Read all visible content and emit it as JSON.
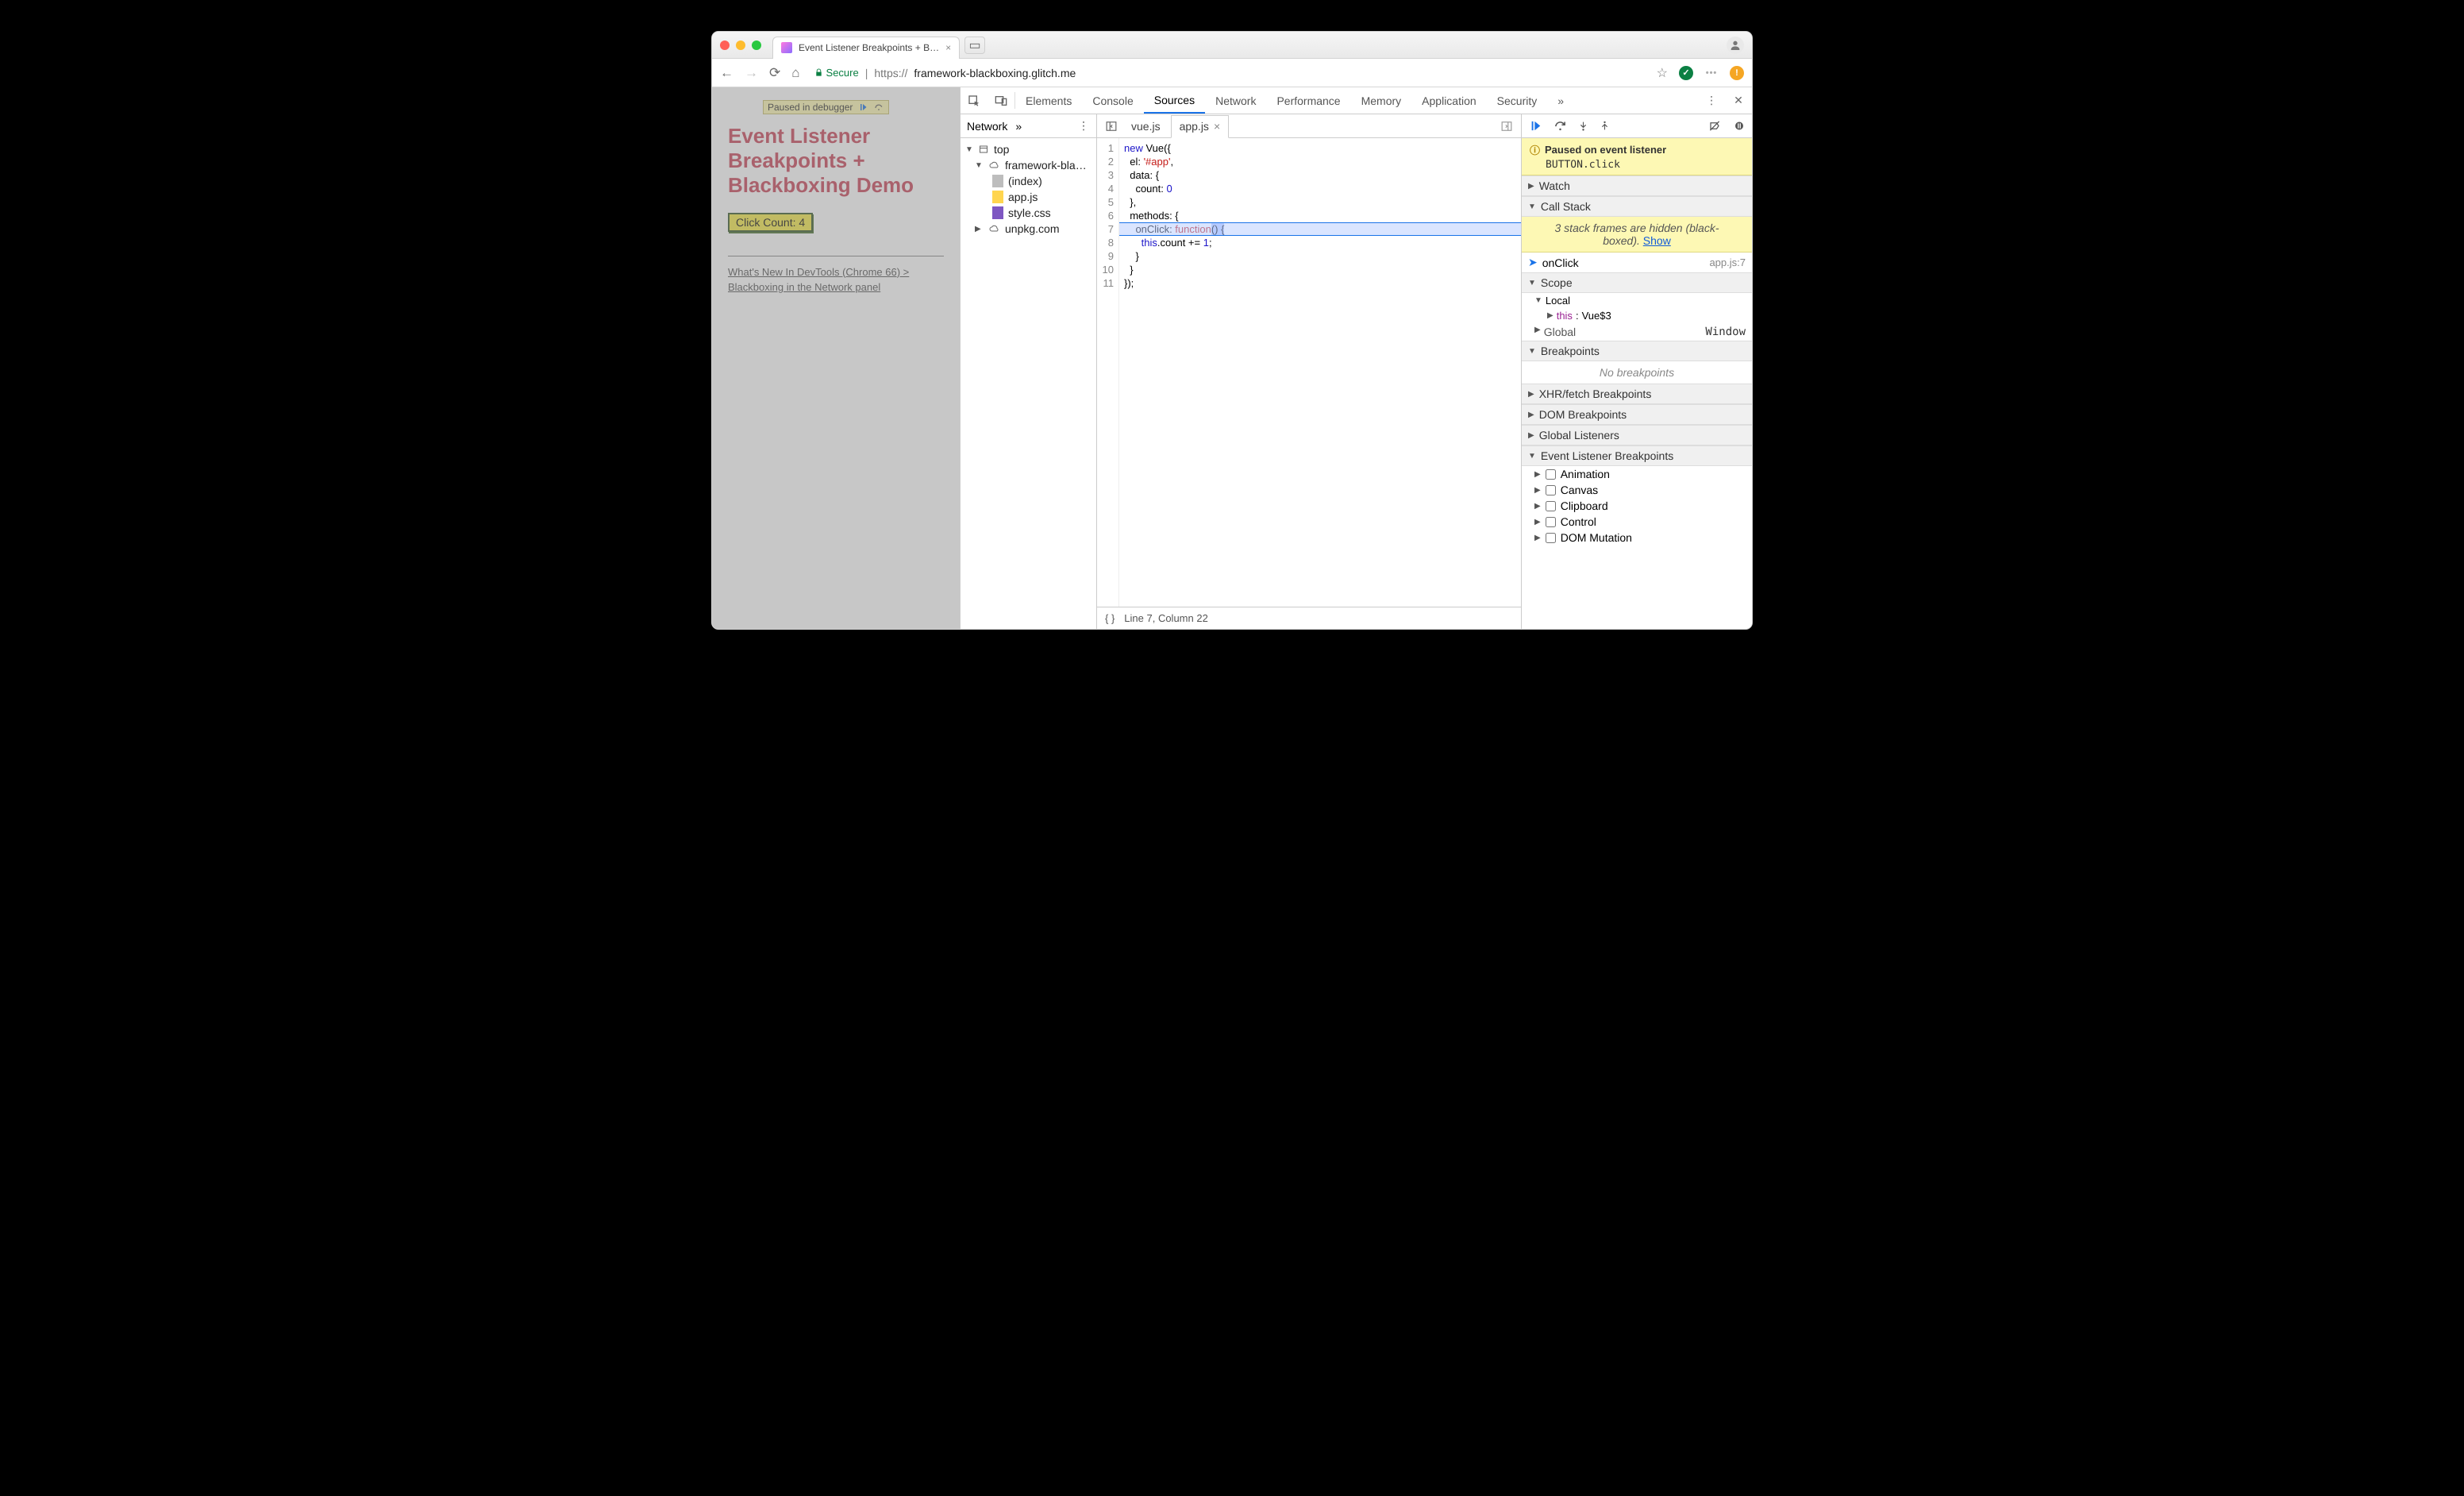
{
  "browser": {
    "tab_title": "Event Listener Breakpoints + B…",
    "secure_label": "Secure",
    "url_scheme": "https://",
    "url_host": "framework-blackboxing.glitch.me",
    "paused_chip": "Paused in debugger"
  },
  "page": {
    "heading": "Event Listener Breakpoints + Blackboxing Demo",
    "button_label": "Click Count: 4",
    "link_text": "What's New In DevTools (Chrome 66) > Blackboxing in the Network panel"
  },
  "devtools": {
    "tabs": [
      "Elements",
      "Console",
      "Sources",
      "Network",
      "Performance",
      "Memory",
      "Application",
      "Security"
    ],
    "active_tab": "Sources",
    "nav_tab": "Network",
    "tree": {
      "top": "top",
      "domain": "framework-bla…",
      "files": [
        "(index)",
        "app.js",
        "style.css"
      ],
      "ext_domain": "unpkg.com"
    },
    "editor_tabs": [
      "vue.js",
      "app.js"
    ],
    "active_file": "app.js",
    "code_lines": [
      "new Vue({",
      "  el: '#app',",
      "  data: {",
      "    count: 0",
      "  },",
      "  methods: {",
      "    onClick: function() {",
      "      this.count += 1;",
      "    }",
      "  }",
      "});"
    ],
    "highlight_line": 7,
    "cursor_status": "Line 7, Column 22",
    "debugger": {
      "banner_title": "Paused on event listener",
      "banner_sub": "BUTTON.click",
      "panes": [
        "Watch",
        "Call Stack",
        "Scope",
        "Breakpoints",
        "XHR/fetch Breakpoints",
        "DOM Breakpoints",
        "Global Listeners",
        "Event Listener Breakpoints"
      ],
      "hidden_frames_msg": "3 stack frames are hidden (black-boxed).",
      "show_link": "Show",
      "frame": {
        "name": "onClick",
        "loc": "app.js:7"
      },
      "scope_local": "Local",
      "scope_this": "this",
      "scope_this_val": "Vue$3",
      "scope_global": "Global",
      "scope_global_val": "Window",
      "no_breakpoints": "No breakpoints",
      "event_categories": [
        "Animation",
        "Canvas",
        "Clipboard",
        "Control",
        "DOM Mutation"
      ]
    }
  }
}
